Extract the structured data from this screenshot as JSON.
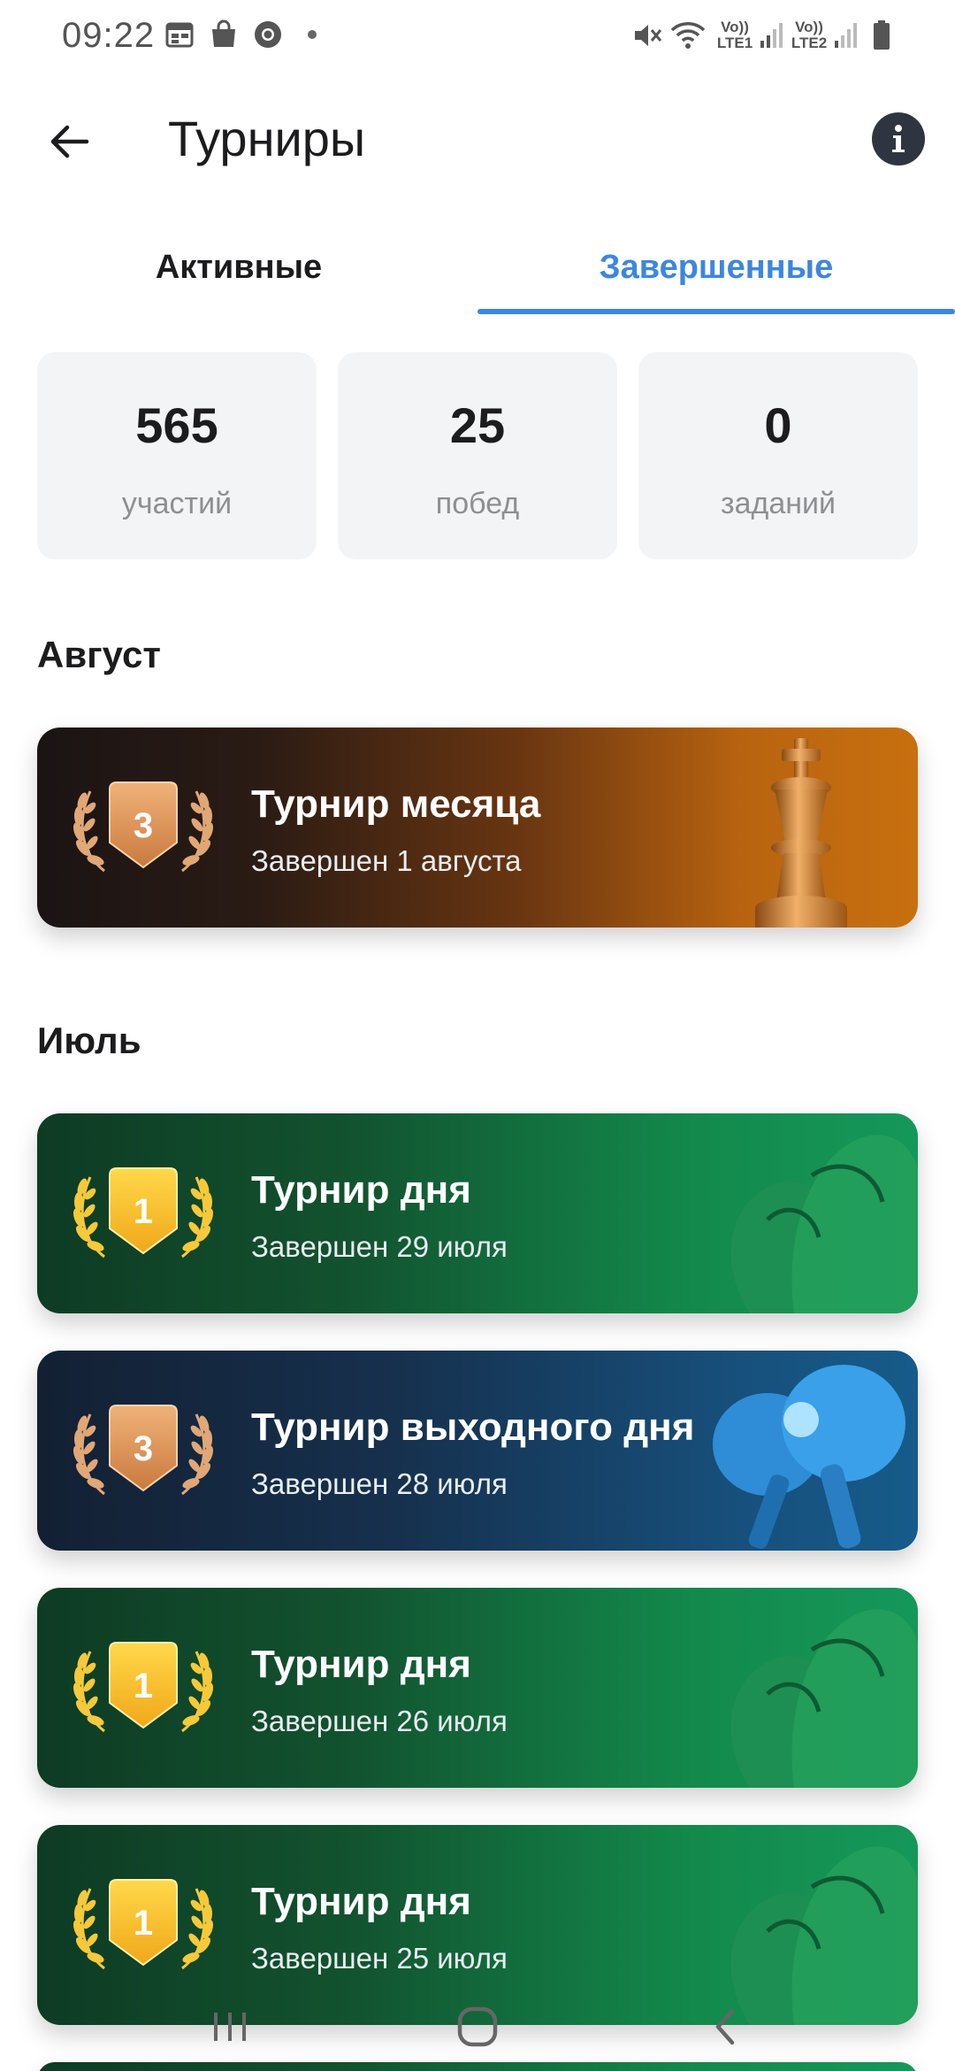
{
  "status_bar": {
    "time": "09:22",
    "icons": [
      "calendar-icon",
      "bag-icon",
      "chrome-icon",
      "notification-dot",
      "mute-icon",
      "wifi-icon",
      "lte1-signal-icon",
      "lte2-signal-icon",
      "battery-icon"
    ],
    "sim1": "Vo)) LTE1",
    "sim2": "Vo)) LTE2"
  },
  "header": {
    "title": "Турниры",
    "back_icon": "arrow-left-icon",
    "info_icon": "info-icon"
  },
  "tabs": [
    {
      "label": "Активные",
      "selected": false
    },
    {
      "label": "Завершенные",
      "selected": true
    }
  ],
  "stats": [
    {
      "value": "565",
      "label": "участий"
    },
    {
      "value": "25",
      "label": "побед"
    },
    {
      "value": "0",
      "label": "заданий"
    }
  ],
  "sections": [
    {
      "title": "Август",
      "tournaments": [
        {
          "title": "Турнир месяца",
          "subtitle": "Завершен 1 августа",
          "place": "3",
          "theme": "orange",
          "art": "chess-king-icon"
        }
      ]
    },
    {
      "title": "Июль",
      "tournaments": [
        {
          "title": "Турнир дня",
          "subtitle": "Завершен 29 июля",
          "place": "1",
          "theme": "green",
          "art": "boxing-gloves-icon"
        },
        {
          "title": "Турнир выходного дня",
          "subtitle": "Завершен 28 июля",
          "place": "3",
          "theme": "blue",
          "art": "ping-pong-icon"
        },
        {
          "title": "Турнир дня",
          "subtitle": "Завершен 26 июля",
          "place": "1",
          "theme": "green",
          "art": "boxing-gloves-icon"
        },
        {
          "title": "Турнир дня",
          "subtitle": "Завершен 25 июля",
          "place": "1",
          "theme": "green",
          "art": "boxing-gloves-icon"
        }
      ]
    }
  ],
  "nav_bar": [
    "recent-apps-icon",
    "home-icon",
    "back-icon"
  ],
  "colors": {
    "accent": "#3d86e0",
    "gold": "#f5b82a",
    "bronze": "#d4905a",
    "green_card": "#12522f",
    "orange_card": "#b86310",
    "blue_card": "#16304d"
  }
}
